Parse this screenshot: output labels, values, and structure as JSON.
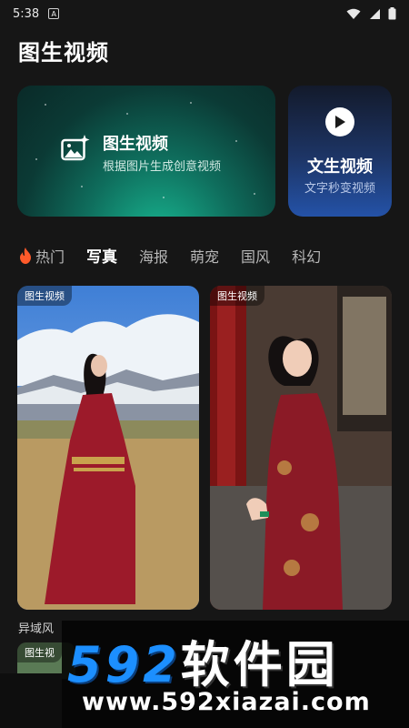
{
  "status_bar": {
    "time": "5:38",
    "badge": "A"
  },
  "page_title": "图生视频",
  "cards": {
    "img2vid": {
      "title": "图生视频",
      "subtitle": "根据图片生成创意视频"
    },
    "txt2vid": {
      "title": "文生视频",
      "subtitle": "文字秒变视频"
    }
  },
  "tabs": [
    {
      "label": "热门",
      "icon": "fire-icon"
    },
    {
      "label": "写真",
      "active": true
    },
    {
      "label": "海报"
    },
    {
      "label": "萌宠"
    },
    {
      "label": "国风"
    },
    {
      "label": "科幻"
    }
  ],
  "gallery": [
    {
      "badge": "图生视频"
    },
    {
      "badge": "图生视频"
    },
    {
      "badge": "图生视"
    }
  ],
  "caption": "异域风",
  "watermark": {
    "logo_num": "592",
    "logo_cn": "软件园",
    "url": "www.592xiazai.com"
  },
  "colors": {
    "accent_green": "#18b892",
    "accent_blue": "#2452a7",
    "background": "#161616"
  }
}
